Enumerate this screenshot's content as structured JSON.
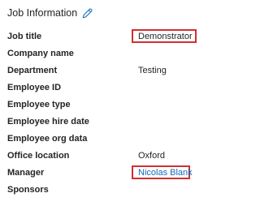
{
  "section": {
    "title": "Job Information",
    "edit_icon": "pencil-icon",
    "accent_color": "#0f6cbd",
    "highlight_color": "#d32f2f"
  },
  "fields": [
    {
      "label": "Job title",
      "value": "Demonstrator"
    },
    {
      "label": "Company name",
      "value": ""
    },
    {
      "label": "Department",
      "value": "Testing"
    },
    {
      "label": "Employee ID",
      "value": ""
    },
    {
      "label": "Employee type",
      "value": ""
    },
    {
      "label": "Employee hire date",
      "value": ""
    },
    {
      "label": "Employee org data",
      "value": ""
    },
    {
      "label": "Office location",
      "value": "Oxford"
    },
    {
      "label": "Manager",
      "value": "Nicolas Blank"
    },
    {
      "label": "Sponsors",
      "value": ""
    }
  ]
}
